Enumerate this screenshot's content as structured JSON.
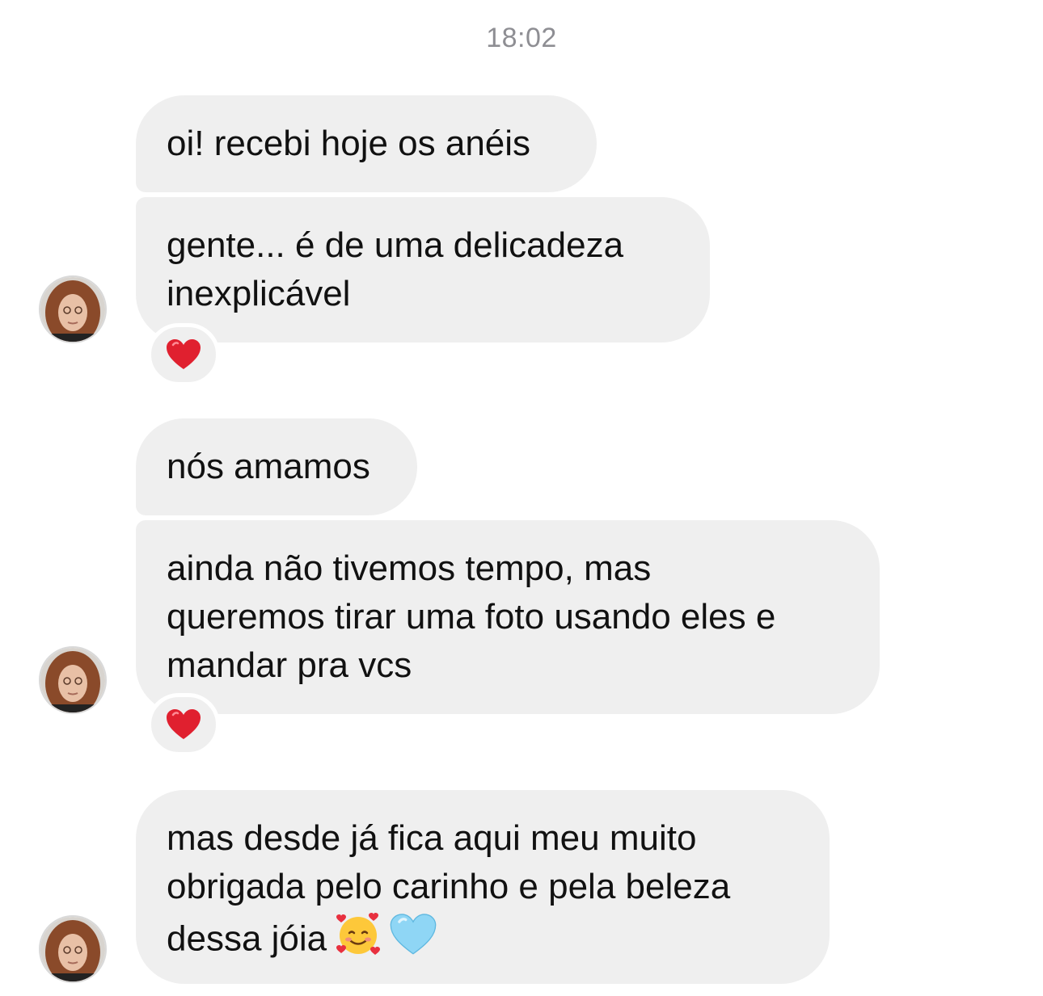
{
  "timestamp": "18:02",
  "messages": [
    {
      "text": "oi! recebi hoje os anéis"
    },
    {
      "lines": [
        "gente... é de uma delicadeza",
        "inexplicável"
      ],
      "reaction": "red-heart"
    },
    {
      "text": "nós amamos"
    },
    {
      "lines": [
        "ainda não tivemos tempo, mas",
        "queremos tirar uma foto usando eles e",
        "mandar pra vcs"
      ],
      "reaction": "red-heart"
    },
    {
      "lines": [
        "mas desde já fica aqui meu muito",
        "obrigada pelo carinho e pela beleza",
        "dessa jóia"
      ],
      "emojis": [
        "smiling-face-with-hearts",
        "light-blue-heart"
      ]
    }
  ],
  "colors": {
    "bubble": "#efefef",
    "timestamp": "#8e8e93",
    "heart_red": "#e0202f",
    "heart_blue": "#8fd6f5"
  }
}
